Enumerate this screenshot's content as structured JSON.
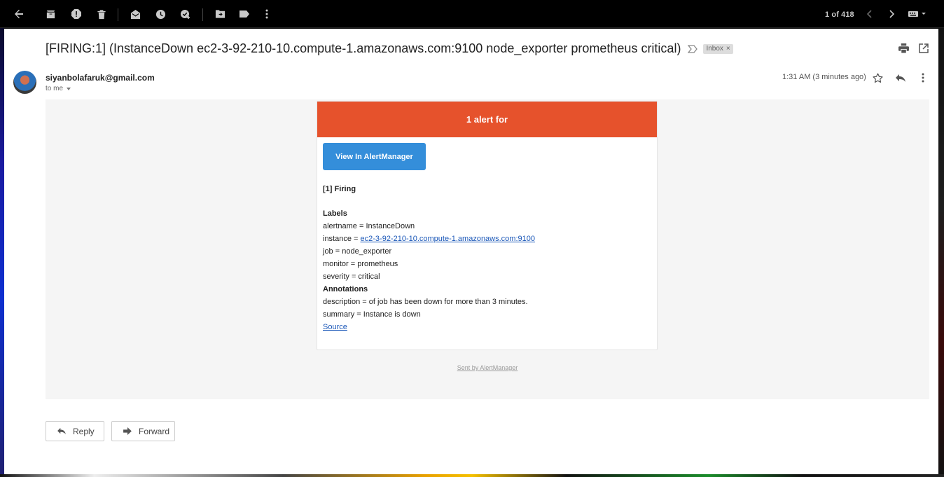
{
  "toolbar": {
    "icons": [
      "back-arrow-icon",
      "archive-icon",
      "report-spam-icon",
      "delete-icon",
      "mark-unread-icon",
      "snooze-icon",
      "add-to-tasks-icon",
      "move-to-icon",
      "labels-icon",
      "more-vert-icon",
      "older-chevron-icon",
      "newer-chevron-icon",
      "keyboard-icon"
    ],
    "count": "1 of 418"
  },
  "message": {
    "subject": "[FIRING:1] (InstanceDown ec2-3-92-210-10.compute-1.amazonaws.com:9100 node_exporter prometheus critical)",
    "label_chip": "Inbox",
    "sender": "siyanbolafaruk@gmail.com",
    "recipient": "to me",
    "timestamp": "1:31 AM (3 minutes ago)"
  },
  "alert": {
    "header": "1 alert for",
    "button": "View In AlertManager",
    "status": "[1] Firing",
    "labels_heading": "Labels",
    "alertname": "alertname = InstanceDown",
    "instance_prefix": "instance = ",
    "instance_link": "ec2-3-92-210-10.compute-1.amazonaws.com:9100",
    "job": "job = node_exporter",
    "monitor": "monitor = prometheus",
    "severity": "severity = critical",
    "annotations_heading": "Annotations",
    "description": "description = of job has been down for more than 3 minutes.",
    "summary": "summary = Instance is down",
    "source": "Source",
    "header_color": "#e6522c",
    "button_color": "#348eda"
  },
  "footer": {
    "sent_by": "Sent by AlertManager"
  },
  "actions": {
    "reply": "Reply",
    "forward": "Forward"
  }
}
